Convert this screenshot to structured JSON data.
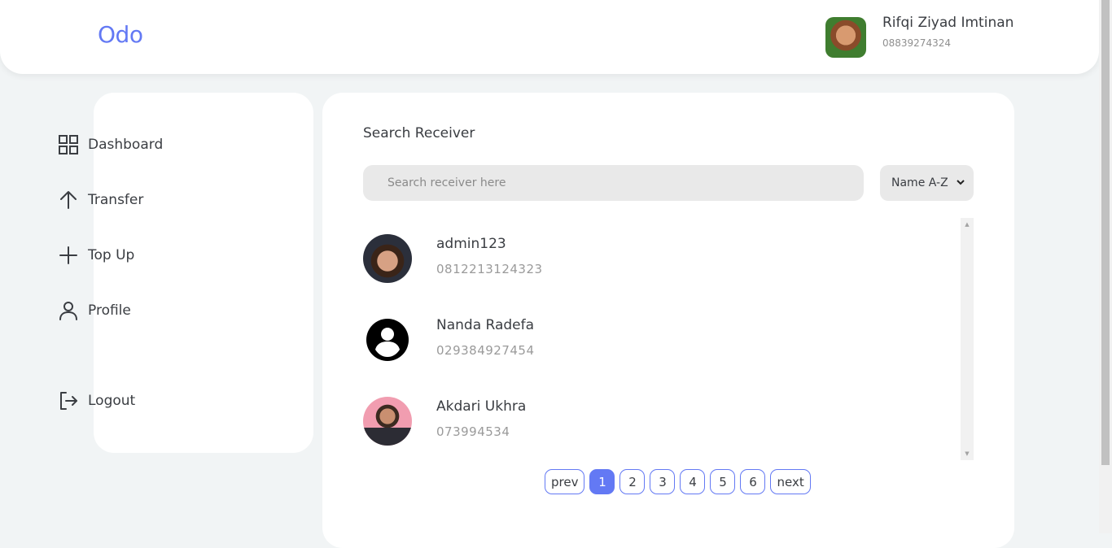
{
  "app": {
    "brand": "Odo"
  },
  "user": {
    "name": "Rifqi Ziyad Imtinan",
    "phone": "08839274324"
  },
  "sidebar": {
    "items": [
      {
        "label": "Dashboard",
        "icon": "grid-icon"
      },
      {
        "label": "Transfer",
        "icon": "arrow-up-icon"
      },
      {
        "label": "Top Up",
        "icon": "plus-icon"
      },
      {
        "label": "Profile",
        "icon": "user-icon"
      }
    ],
    "logout": {
      "label": "Logout",
      "icon": "logout-icon"
    }
  },
  "main": {
    "title": "Search Receiver",
    "search": {
      "placeholder": "Search receiver here",
      "value": ""
    },
    "sort": {
      "selected": "Name A-Z"
    },
    "receivers": [
      {
        "name": "admin123",
        "phone": "0812213124323"
      },
      {
        "name": "Nanda Radefa",
        "phone": "029384927454"
      },
      {
        "name": "Akdari Ukhra",
        "phone": "073994534"
      }
    ],
    "pagination": {
      "prev": "prev",
      "next": "next",
      "pages": [
        "1",
        "2",
        "3",
        "4",
        "5",
        "6"
      ],
      "current": "1"
    }
  },
  "colors": {
    "accent": "#6379f4",
    "background": "#f1f4f5",
    "card": "#ffffff"
  }
}
